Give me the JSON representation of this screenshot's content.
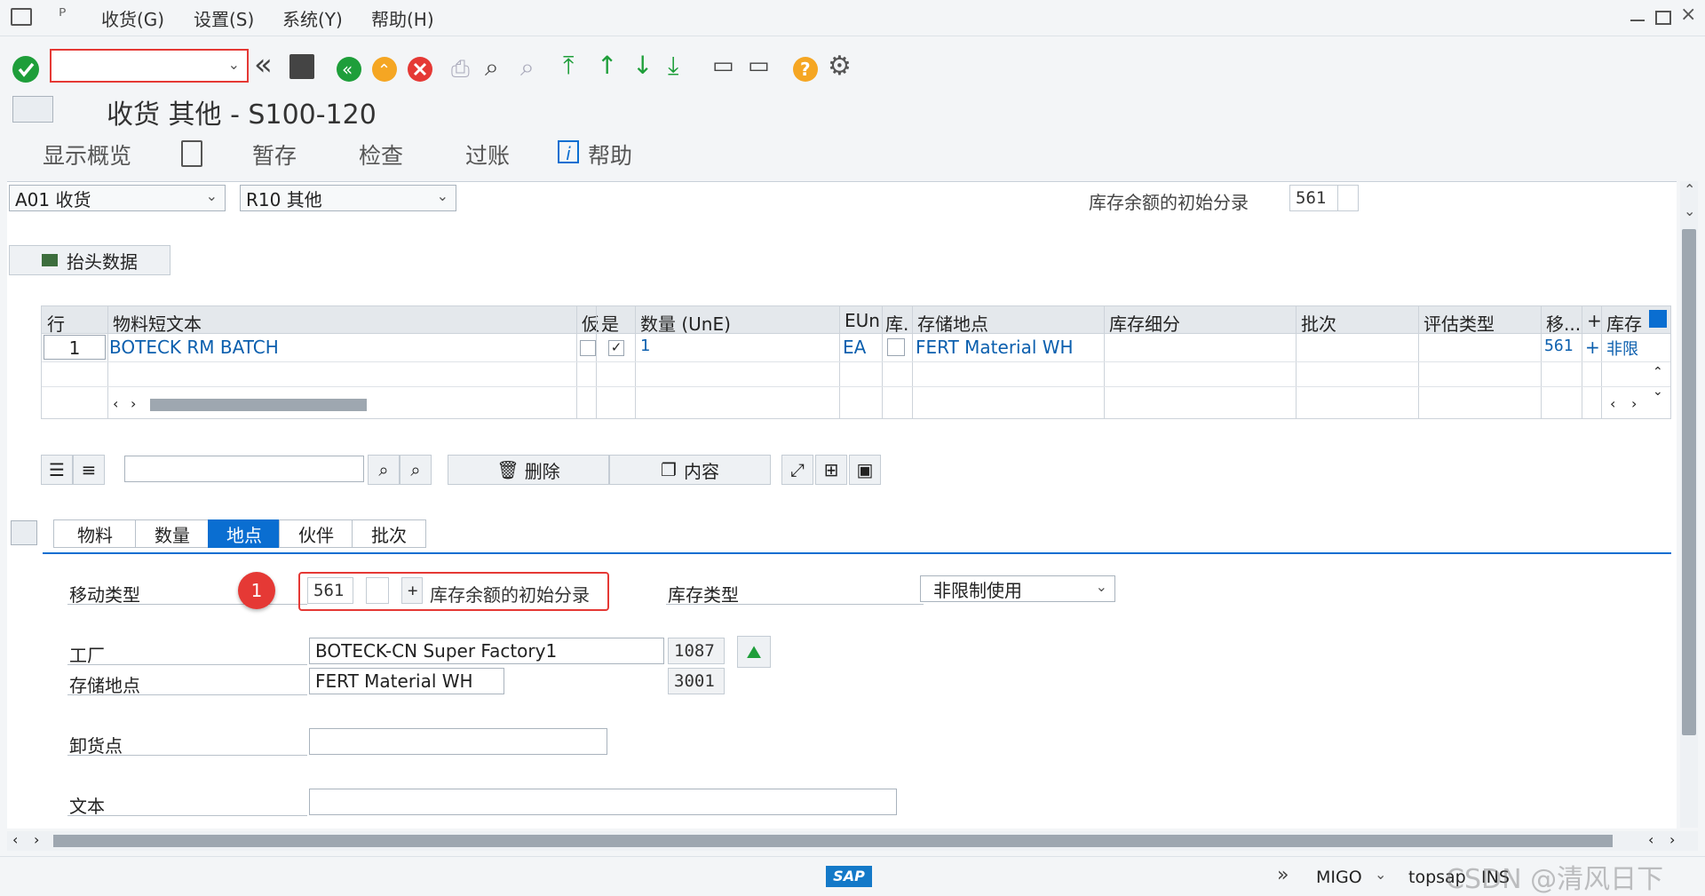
{
  "menu": {
    "items": [
      "收货(G)",
      "设置(S)",
      "系统(Y)",
      "帮助(H)"
    ]
  },
  "title": "收货 其他 - S100-120",
  "appbar": {
    "show_overview": "显示概览",
    "park": "暂存",
    "check": "检查",
    "post": "过账",
    "help": "帮助"
  },
  "header": {
    "action_select": "A01 收货",
    "ref_select": "R10 其他",
    "movement_label": "库存余额的初始分录",
    "movement_code": "561",
    "header_data_button": "抬头数据"
  },
  "grid": {
    "columns": [
      "行",
      "物料短文本",
      "仮",
      "是",
      "数量 (UnE)",
      "EUn",
      "库.",
      "存储地点",
      "库存细分",
      "批次",
      "评估类型",
      "移...",
      "+",
      "库存"
    ],
    "rows": [
      {
        "line": "1",
        "material": "BOTECK RM BATCH",
        "ok_checked": true,
        "qty": "1",
        "unit": "EA",
        "storage": "FERT Material WH",
        "move_type": "561",
        "plus": "+",
        "stock": "非限"
      }
    ],
    "toolbar": {
      "delete": "删除",
      "content": "内容"
    }
  },
  "tabs": [
    "物料",
    "数量",
    "地点",
    "伙伴",
    "批次"
  ],
  "active_tab": "地点",
  "detail": {
    "movement_type_label": "移动类型",
    "badge": "1",
    "movement_code": "561",
    "movement_plus": "+",
    "movement_text": "库存余额的初始分录",
    "stock_type_label": "库存类型",
    "stock_type_value": "非限制使用",
    "plant_label": "工厂",
    "plant_name": "BOTECK-CN Super Factory1",
    "plant_code": "1087",
    "sloc_label": "存储地点",
    "sloc_name": "FERT Material WH",
    "sloc_code": "3001",
    "unloading_label": "卸货点",
    "unloading_value": "",
    "text_label": "文本",
    "text_value": ""
  },
  "status": {
    "program": "MIGO",
    "server": "topsap",
    "mode": "INS",
    "watermark": "CSDN @清风日下"
  },
  "colors": {
    "accent": "#0a6ed1",
    "link": "#0b5fae",
    "highlight": "#e53935",
    "success": "#1e9e3a"
  }
}
